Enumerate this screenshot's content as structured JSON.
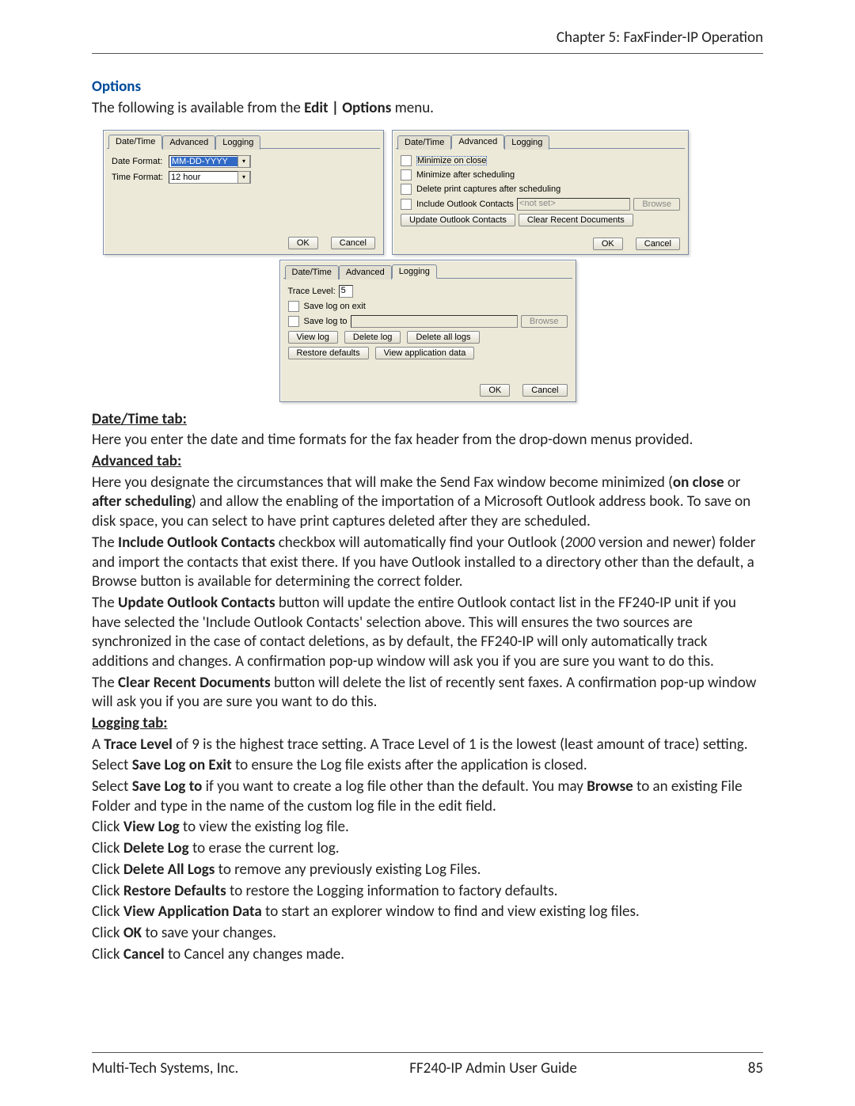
{
  "header": {
    "chapter": "Chapter 5: FaxFinder-IP Operation"
  },
  "section": {
    "title": "Options"
  },
  "intro": {
    "pre": "The following is available from the ",
    "menu": "Edit | Options",
    "post": " menu."
  },
  "tabs": {
    "datetime": "Date/Time",
    "advanced": "Advanced",
    "logging": "Logging"
  },
  "dialog1": {
    "date_format_label": "Date Format:",
    "date_format_value": "MM-DD-YYYY",
    "time_format_label": "Time Format:",
    "time_format_value": "12 hour",
    "ok": "OK",
    "cancel": "Cancel"
  },
  "dialog2": {
    "min_close": "Minimize on close",
    "min_sched": "Minimize after scheduling",
    "del_print": "Delete print captures after scheduling",
    "inc_outlook": "Include Outlook Contacts",
    "outlook_path": "<not set>",
    "browse": "Browse",
    "update_outlook": "Update Outlook Contacts",
    "clear_recent": "Clear Recent Documents",
    "ok": "OK",
    "cancel": "Cancel"
  },
  "dialog3": {
    "trace_label": "Trace Level:",
    "trace_value": "5",
    "save_exit": "Save log on exit",
    "save_to": "Save log to",
    "browse": "Browse",
    "view_log": "View log",
    "delete_log": "Delete log",
    "delete_all": "Delete all logs",
    "restore": "Restore defaults",
    "view_app": "View application data",
    "ok": "OK",
    "cancel": "Cancel"
  },
  "headings": {
    "datetime": "Date/Time tab",
    "advanced": "Advanced tab",
    "logging": "Logging tab"
  },
  "text": {
    "datetime_p1": "Here you enter the date and time formats for the fax header from the drop-down menus provided.",
    "adv_p1_a": "Here you designate the circumstances that will make the Send Fax window become minimized (",
    "adv_p1_b": "on close",
    "adv_p1_c": " or ",
    "adv_p1_d": "after scheduling",
    "adv_p1_e": ") and allow the enabling of the importation of a Microsoft Outlook address book. To save on disk space, you can select to have print captures deleted after they are scheduled.",
    "adv_p2_a": "The ",
    "adv_p2_b": "Include Outlook Contacts",
    "adv_p2_c": " checkbox will automatically find your Outlook (",
    "adv_p2_d": "2000",
    "adv_p2_e": " version and newer) folder and import the contacts that exist there. If you have Outlook installed to a directory other than the default, a Browse button is available for determining the correct folder.",
    "adv_p3_a": "The ",
    "adv_p3_b": "Update Outlook Contacts",
    "adv_p3_c": " button will update the entire Outlook contact list in the FF240-IP unit if you have selected the 'Include Outlook Contacts' selection above. This will ensures the two sources are synchronized in the case of contact deletions, as by default, the FF240-IP will only automatically track additions and changes. A confirmation pop-up window will ask you if you are sure you want to do this.",
    "adv_p4_a": "The ",
    "adv_p4_b": "Clear Recent Documents",
    "adv_p4_c": " button will delete the list of recently sent faxes. A confirmation pop-up window will ask you if you are sure you want to do this.",
    "log_p1_a": "A ",
    "log_p1_b": "Trace Level",
    "log_p1_c": " of 9 is the highest trace setting. A Trace Level of 1 is the lowest (least amount of trace) setting.",
    "log_p2_a": "Select ",
    "log_p2_b": "Save Log on Exit",
    "log_p2_c": " to ensure the Log file exists after the application is closed.",
    "log_p3_a": "Select ",
    "log_p3_b": "Save Log to",
    "log_p3_c": " if you want to create a log file other than the default. You may ",
    "log_p3_d": "Browse",
    "log_p3_e": " to an existing File Folder and type in the name of the custom log file in the edit field.",
    "log_p4_a": "Click ",
    "log_p4_b": "View Log",
    "log_p4_c": " to view the existing log file.",
    "log_p5_a": "Click ",
    "log_p5_b": "Delete Log",
    "log_p5_c": " to erase the current log.",
    "log_p6_a": "Click ",
    "log_p6_b": "Delete All Logs",
    "log_p6_c": " to remove any previously existing Log Files.",
    "log_p7_a": "Click ",
    "log_p7_b": "Restore Defaults",
    "log_p7_c": " to restore the Logging information to factory defaults.",
    "log_p8_a": "Click ",
    "log_p8_b": "View Application Data",
    "log_p8_c": " to start an explorer window to find and view existing log files.",
    "log_p9_a": "Click ",
    "log_p9_b": "OK",
    "log_p9_c": " to save your changes.",
    "log_p10_a": "Click ",
    "log_p10_b": "Cancel",
    "log_p10_c": " to Cancel any changes made."
  },
  "footer": {
    "left": "Multi-Tech Systems, Inc.",
    "center": "FF240-IP Admin User Guide",
    "right": "85"
  }
}
